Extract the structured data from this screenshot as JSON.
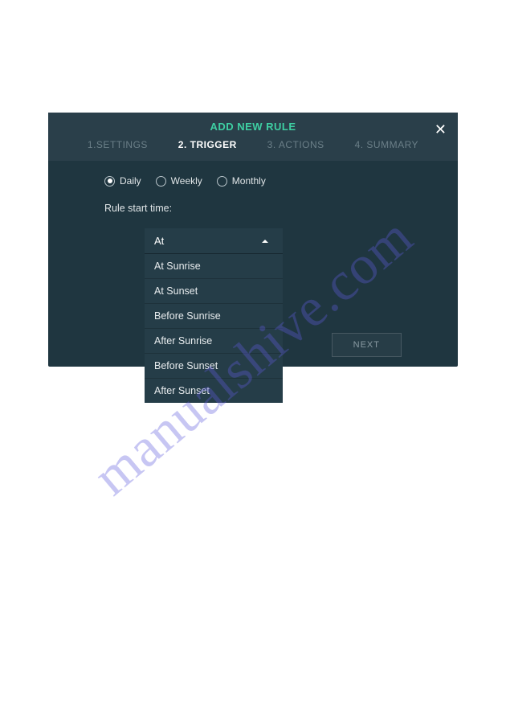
{
  "modal": {
    "title": "ADD NEW RULE",
    "tabs": [
      {
        "label": "1.SETTINGS"
      },
      {
        "label": "2. TRIGGER"
      },
      {
        "label": "3. ACTIONS"
      },
      {
        "label": "4. SUMMARY"
      }
    ],
    "frequency": {
      "options": [
        {
          "label": "Daily",
          "selected": true
        },
        {
          "label": "Weekly",
          "selected": false
        },
        {
          "label": "Monthly",
          "selected": false
        }
      ]
    },
    "rule_start_label": "Rule start time:",
    "dropdown": {
      "selected": "At",
      "options": [
        "At Sunrise",
        "At Sunset",
        "Before Sunrise",
        "After Sunrise",
        "Before Sunset",
        "After Sunset"
      ]
    },
    "next_button": "NEXT"
  },
  "watermark": "manualshive.com"
}
